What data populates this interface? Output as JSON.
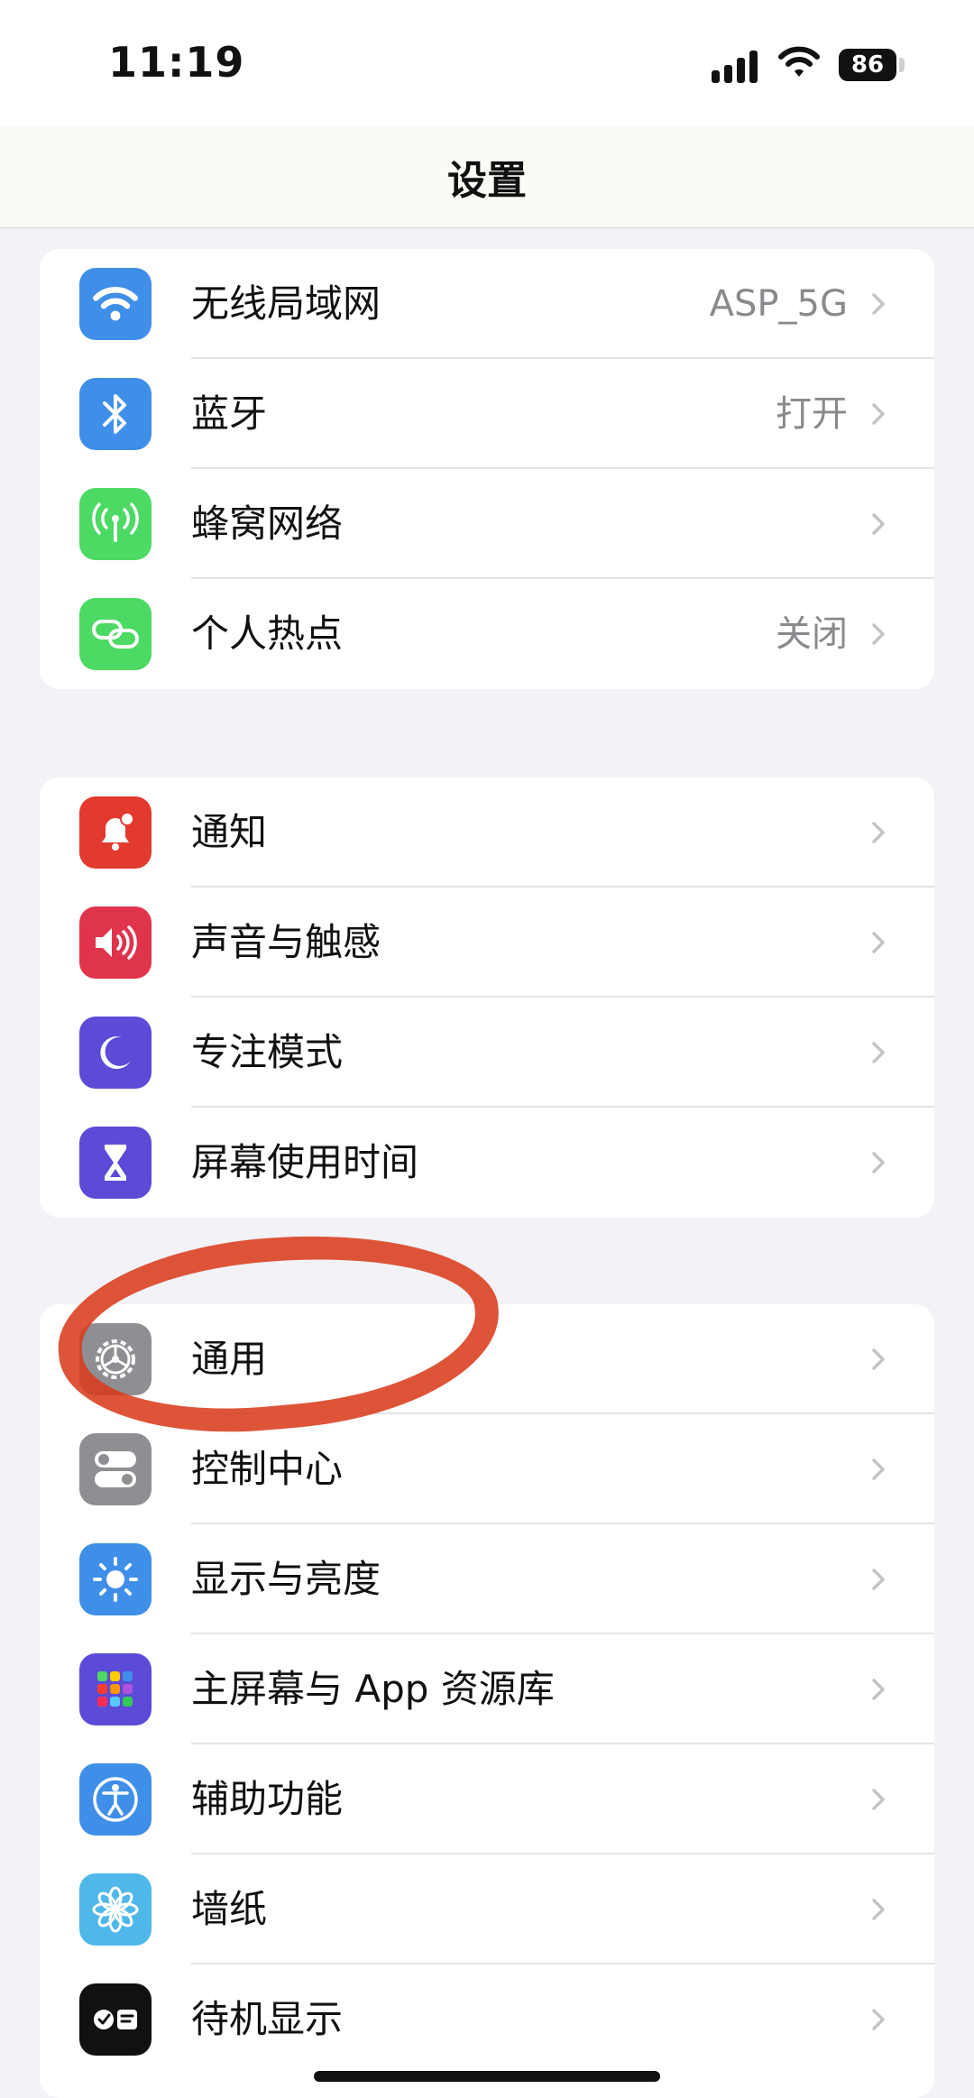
{
  "status_bar": {
    "time": "11:19",
    "battery": "86"
  },
  "nav": {
    "title": "设置"
  },
  "groups": {
    "connectivity": [
      {
        "label": "无线局域网",
        "value": "ASP_5G",
        "icon": "wifi-icon",
        "color": "#3f8ee8"
      },
      {
        "label": "蓝牙",
        "value": "打开",
        "icon": "bluetooth-icon",
        "color": "#3f8ee8"
      },
      {
        "label": "蜂窝网络",
        "value": "",
        "icon": "antenna-icon",
        "color": "#4cd964"
      },
      {
        "label": "个人热点",
        "value": "关闭",
        "icon": "chain-link-icon",
        "color": "#4cd964"
      }
    ],
    "notifications": [
      {
        "label": "通知",
        "icon": "bell-icon",
        "color": "#e23a2e"
      },
      {
        "label": "声音与触感",
        "icon": "speaker-icon",
        "color": "#e0334c"
      },
      {
        "label": "专注模式",
        "icon": "moon-icon",
        "color": "#5b4bd6"
      },
      {
        "label": "屏幕使用时间",
        "icon": "hourglass-icon",
        "color": "#5b4bd6"
      }
    ],
    "general": [
      {
        "label": "通用",
        "icon": "gear-icon",
        "color": "#8e8e93"
      },
      {
        "label": "控制中心",
        "icon": "toggles-icon",
        "color": "#8e8e93"
      },
      {
        "label": "显示与亮度",
        "icon": "sun-icon",
        "color": "#3f8ee8"
      },
      {
        "label": "主屏幕与 App 资源库",
        "icon": "app-grid-icon",
        "color": "#5b4bd6"
      },
      {
        "label": "辅助功能",
        "icon": "accessibility-icon",
        "color": "#3f8ee8"
      },
      {
        "label": "墙纸",
        "icon": "flower-icon",
        "color": "#4fb8e8"
      },
      {
        "label": "待机显示",
        "icon": "standby-icon",
        "color": "#111111"
      }
    ]
  }
}
